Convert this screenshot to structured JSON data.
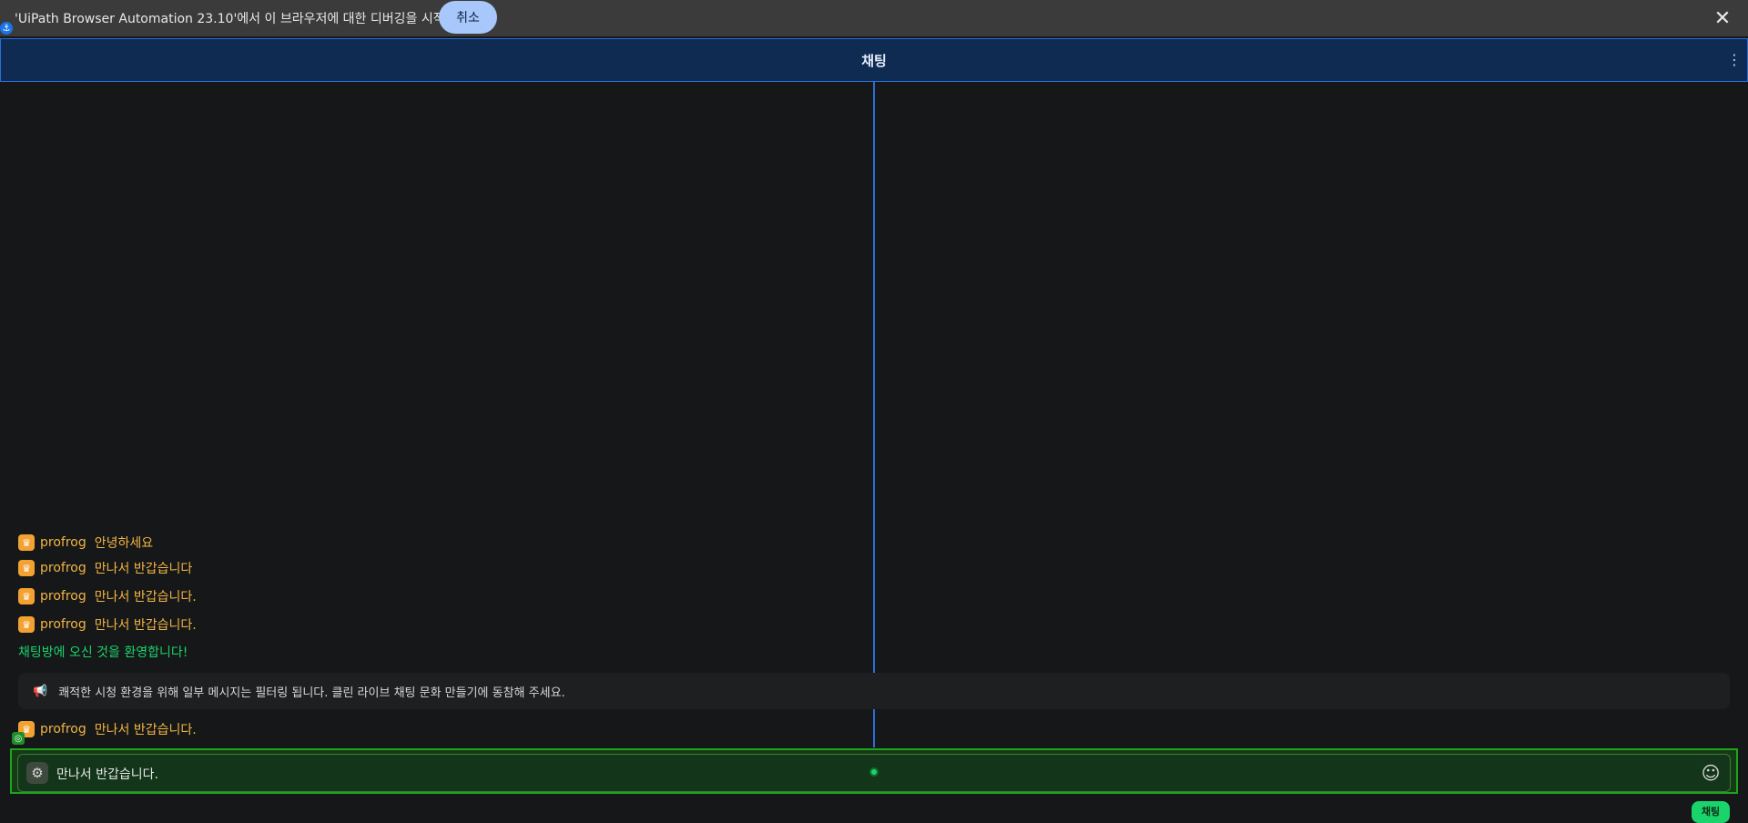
{
  "banner": {
    "text": "'UiPath Browser Automation 23.10'에서 이 브라우저에 대한 디버깅을 시작함",
    "cancel_label": "취소",
    "close_symbol": "✕"
  },
  "header": {
    "title": "채팅",
    "menu_symbol": "⋮"
  },
  "messages": [
    {
      "user": "profrog",
      "text": "안녕하세요"
    },
    {
      "user": "profrog",
      "text": "만나서 반갑습니다"
    },
    {
      "user": "profrog",
      "text": "만나서 반갑습니다."
    },
    {
      "user": "profrog",
      "text": "만나서 반갑습니다."
    }
  ],
  "welcome": "채팅방에 오신 것을 환영합니다!",
  "notice": {
    "icon": "megaphone-icon",
    "text": "쾌적한 시청 환경을 위해 일부 메시지는 필터링 됩니다. 클린 라이브 채팅 문화 만들기에 동참해 주세요."
  },
  "last_message": {
    "user": "profrog",
    "text": "만나서 반갑습니다."
  },
  "input": {
    "value": "만나서 반갑습니다."
  },
  "send_label": "채팅",
  "colors": {
    "accent": "#2a6edb",
    "highlight_green": "#1fa31f",
    "username": "#f2b544",
    "welcome": "#19d46b"
  }
}
